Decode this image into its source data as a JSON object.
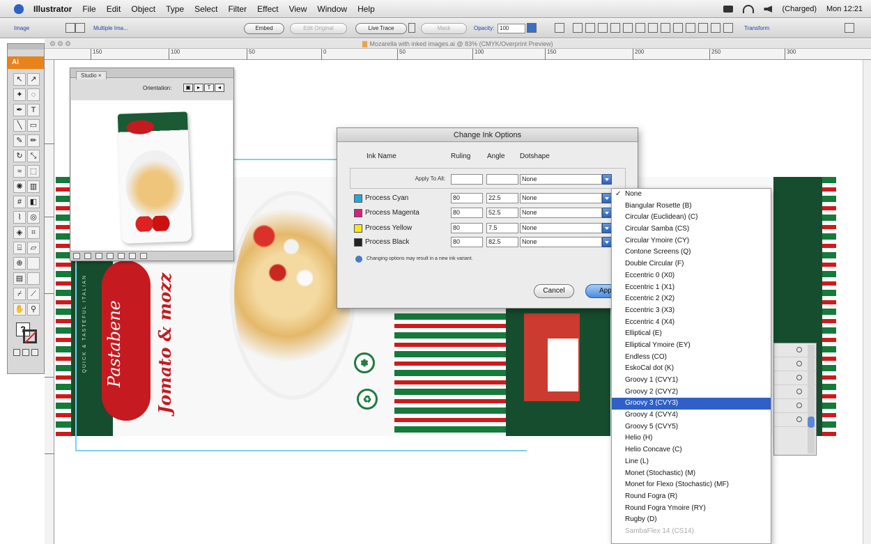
{
  "menubar": {
    "items": [
      "Illustrator",
      "File",
      "Edit",
      "Object",
      "Type",
      "Select",
      "Filter",
      "Effect",
      "View",
      "Window",
      "Help"
    ],
    "battery": "(Charged)",
    "clock": "Mon 12:21"
  },
  "controlbar": {
    "left_label": "Image",
    "multiple": "Multiple Ima...",
    "embed": "Embed",
    "edit_original": "Edit Original",
    "live_trace": "Live Trace",
    "mask": "Mask",
    "opacity_label": "Opacity:",
    "opacity_value": "100",
    "transform": "Transform"
  },
  "document": {
    "title": "Mozarella with inked images.ai @ 83% (CMYK/Overprint Preview)"
  },
  "ruler": {
    "h_ticks": [
      "150",
      "100",
      "50",
      "0",
      "50",
      "100",
      "150",
      "200",
      "250",
      "300"
    ]
  },
  "tools": {
    "tab": "Ai"
  },
  "studio": {
    "tab": "Studio ×",
    "orientation_label": "Orientation:"
  },
  "artwork": {
    "brand": "Pastabene",
    "product": "Jomato & mozz",
    "tag": "QUICK & TASTEFUL ITALIAN"
  },
  "dialog": {
    "title": "Change Ink Options",
    "headers": {
      "ink_name": "Ink Name",
      "ruling": "Ruling",
      "angle": "Angle",
      "dotshape": "Dotshape"
    },
    "apply_to_all_label": "Apply To All:",
    "apply_to_all_dotshape": "None",
    "inks": [
      {
        "name": "Process Cyan",
        "ruling": "80",
        "angle": "22.5",
        "dotshape": "None",
        "color": "#1fa9dc"
      },
      {
        "name": "Process Magenta",
        "ruling": "80",
        "angle": "52.5",
        "dotshape": "None",
        "color": "#d6217a"
      },
      {
        "name": "Process Yellow",
        "ruling": "80",
        "angle": "7.5",
        "dotshape": "None",
        "color": "#f2e81a"
      },
      {
        "name": "Process Black",
        "ruling": "80",
        "angle": "82.5",
        "dotshape": "None",
        "color": "#222222"
      }
    ],
    "note": "Changing options may result in a new ink variant.",
    "cancel": "Cancel",
    "apply": "Appl"
  },
  "dropdown": {
    "items": [
      "None",
      "Biangular Rosette (B)",
      "Circular (Euclidean) (C)",
      "Circular Samba (CS)",
      "Circular Ymoire (CY)",
      "Contone Screens (Q)",
      "Double Circular (F)",
      "Eccentric 0 (X0)",
      "Eccentric 1 (X1)",
      "Eccentric 2 (X2)",
      "Eccentric 3 (X3)",
      "Eccentric 4 (X4)",
      "Elliptical (E)",
      "Elliptical Ymoire (EY)",
      "Endless (CO)",
      "EskoCal dot (K)",
      "Groovy 1 (CVY1)",
      "Groovy 2 (CVY2)",
      "Groovy 3 (CVY3)",
      "Groovy 4 (CVY4)",
      "Groovy 5 (CVY5)",
      "Helio (H)",
      "Helio Concave (C)",
      "Line (L)",
      "Monet (Stochastic) (M)",
      "Monet for Flexo (Stochastic) (MF)",
      "Round Fogra (R)",
      "Round Fogra Ymoire (RY)",
      "Rugby (D)",
      "SambaFlex 14 (CS14)"
    ],
    "checked_index": 0,
    "highlight_index": 18
  }
}
